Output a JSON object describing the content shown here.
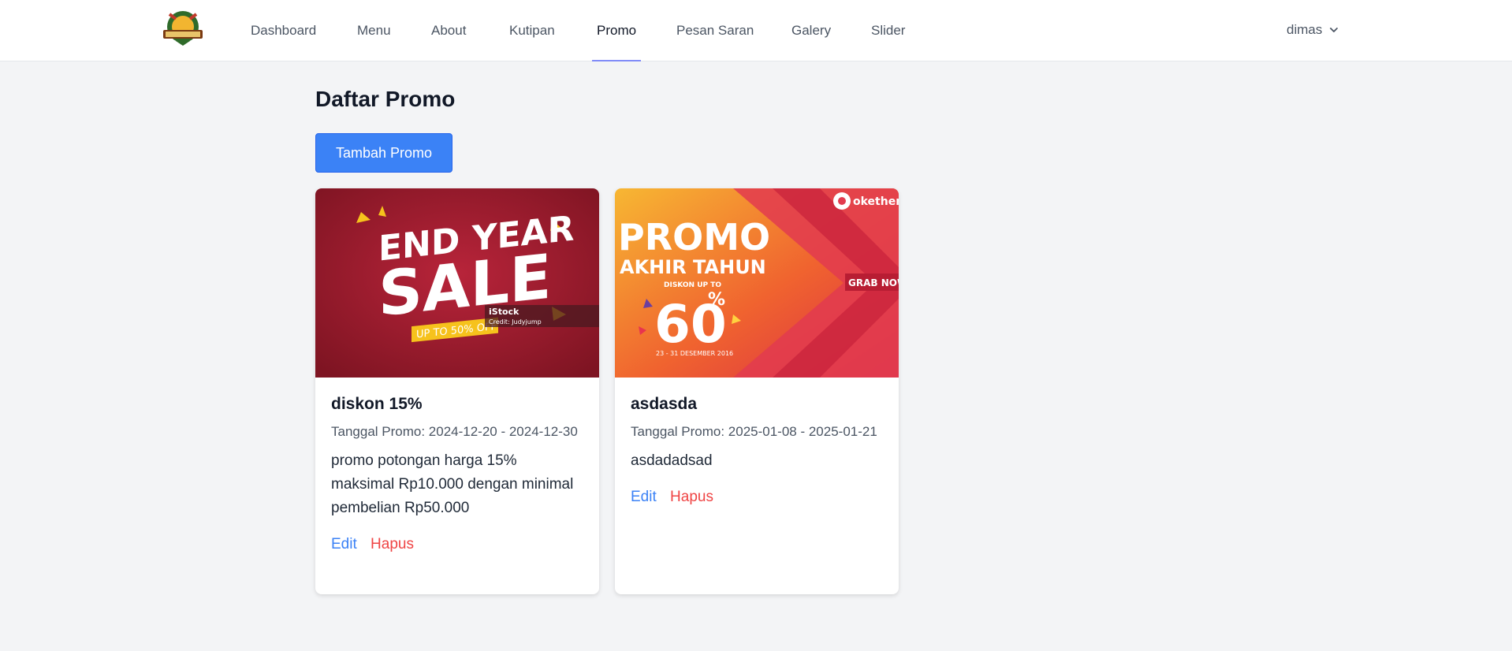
{
  "nav": {
    "logo_alt": "logo",
    "items": [
      {
        "label": "Dashboard"
      },
      {
        "label": "Menu"
      },
      {
        "label": "About"
      },
      {
        "label": "Kutipan"
      },
      {
        "label": "Promo",
        "active": true
      },
      {
        "label": "Pesan Saran"
      },
      {
        "label": "Galery"
      },
      {
        "label": "Slider"
      }
    ],
    "user": "dimas"
  },
  "page": {
    "title": "Daftar Promo",
    "add_button": "Tambah Promo"
  },
  "promos": [
    {
      "title": "diskon 15%",
      "date": "Tanggal Promo: 2024-12-20 - 2024-12-30",
      "description": "promo potongan harga 15% maksimal Rp10.000 dengan minimal pembelian Rp50.000",
      "edit": "Edit",
      "delete": "Hapus",
      "banner": {
        "line1": "END YEAR",
        "line2": "SALE",
        "tag": "UP TO 50% OFF",
        "watermark": "iStock",
        "credit": "Credit: Judyjump",
        "colors": {
          "bg": "#9f1c2b",
          "tag": "#f6c21c"
        }
      }
    },
    {
      "title": "asdasda",
      "date": "Tanggal Promo: 2025-01-08 - 2025-01-21",
      "description": "asdadadsad",
      "edit": "Edit",
      "delete": "Hapus",
      "banner": {
        "line1": "PROMO",
        "line2": "AKHIR TAHUN",
        "discount_label": "DISKON UP TO",
        "discount": "60",
        "percent": "%",
        "dates": "23 - 31 DESEMBER 2016",
        "brand": "okethem",
        "cta": "GRAB NOW",
        "colors": {
          "from": "#f5a623",
          "to": "#e8344e"
        }
      }
    }
  ],
  "colors": {
    "primary": "#3b82f6",
    "danger": "#ef4444",
    "nav_active_underline": "#818cf8",
    "page_bg": "#f3f4f6"
  }
}
